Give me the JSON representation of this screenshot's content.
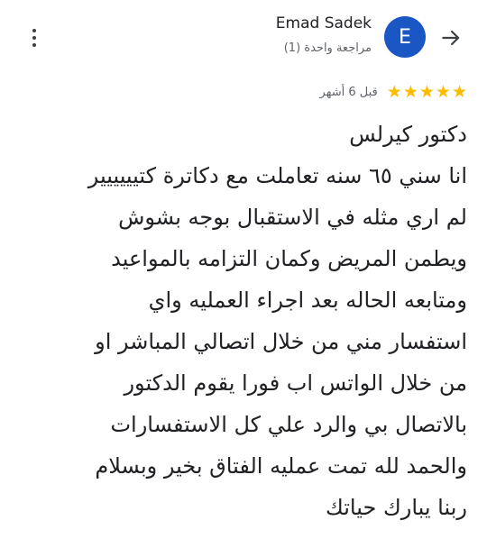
{
  "header": {
    "reviewer_name": "Emad Sadek",
    "review_count": "مراجعة واحدة (1)",
    "avatar_initial": "E",
    "avatar_color": "#1a56c4",
    "back_icon": "arrow-back-icon",
    "more_icon": "more-vert-icon"
  },
  "review": {
    "rating": 5,
    "rating_max": 5,
    "star_color": "#fbbc04",
    "time_ago": "قبل 6 أشهر",
    "lines": [
      "دكتور كيرلس",
      "انا سني ٦٥ سنه تعاملت مع دكاترة كتيييييير",
      "لم اري مثله في الاستقبال بوجه بشوش",
      "ويطمن المريض وكمان التزامه بالمواعيد",
      "ومتابعه الحاله بعد اجراء العمليه واي",
      "استفسار مني من خلال اتصالي المباشر او",
      "من خلال الواتس اب فورا يقوم الدكتور",
      "بالاتصال بي والرد علي كل الاستفسارات",
      "والحمد لله تمت عمليه الفتاق بخير وبسلام",
      "ربنا يبارك حياتك"
    ]
  }
}
